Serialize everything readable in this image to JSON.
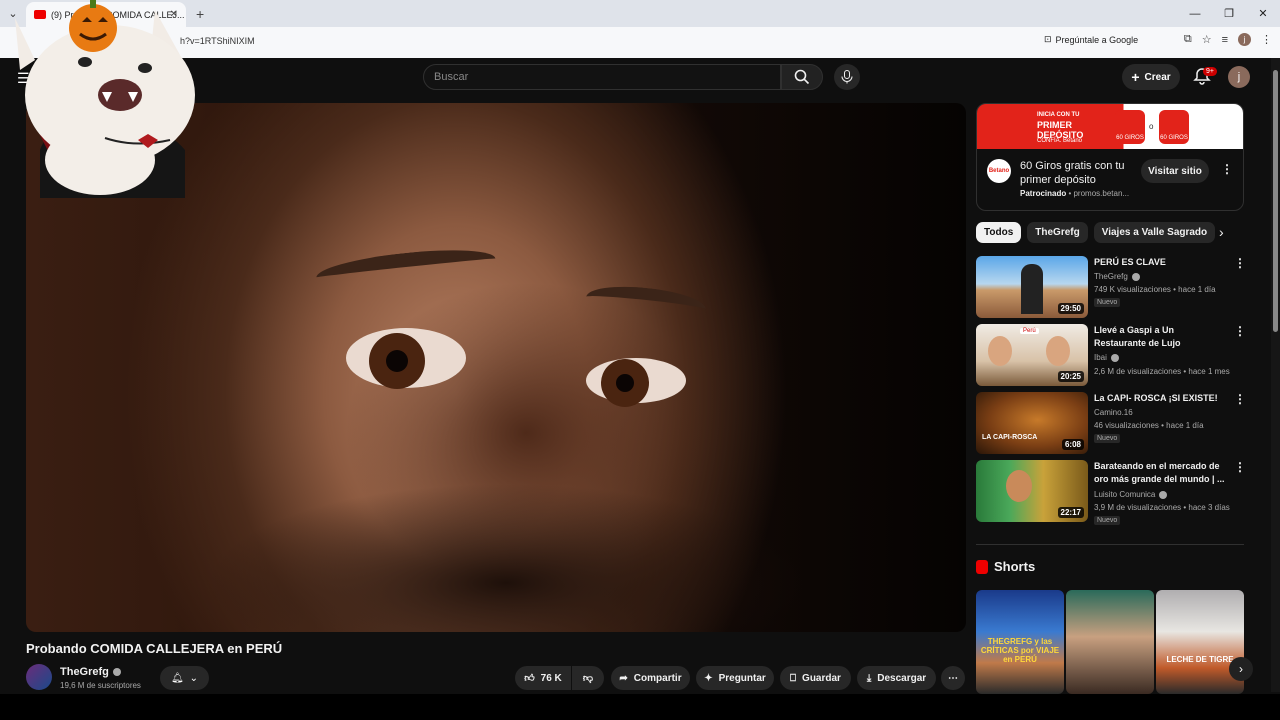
{
  "browser": {
    "tab_title": "(9) Probando COMIDA CALLEJ...",
    "url_text": "h?v=1RTShiNIXIM",
    "google_button": "Pregúntale a Google",
    "profile_letter": "j"
  },
  "header": {
    "search_placeholder": "Buscar",
    "create_label": "Crear",
    "notif_badge": "9+",
    "avatar_letter": "j"
  },
  "video": {
    "title": "Probando COMIDA CALLEJERA en PERÚ",
    "channel": "TheGrefg",
    "subscribers": "19,6 M de suscriptores",
    "likes": "76 K",
    "share_label": "Compartir",
    "ask_label": "Preguntar",
    "save_label": "Guardar",
    "download_label": "Descargar"
  },
  "ad": {
    "banner_line1": "INICIA CON TU",
    "banner_line2": "PRIMER DEPÓSITO",
    "banner_line3": "CONFÍA. Betano",
    "coin1": "60 GIROS",
    "coin_or": "o",
    "coin2": "60 GIROS",
    "logo": "Betano",
    "title": "60 Giros gratis con tu primer depósito",
    "sponsored": "Patrocinado",
    "domain": "promos.betan...",
    "visit": "Visitar sitio"
  },
  "chips": [
    "Todos",
    "TheGrefg",
    "Viajes a Valle Sagrado"
  ],
  "recommendations": [
    {
      "title": "PERÚ ES CLAVE",
      "channel": "TheGrefg",
      "meta": "749 K visualizaciones • hace 1 día",
      "badge": "Nuevo",
      "duration": "29:50"
    },
    {
      "title": "Llevé a Gaspi a Un Restaurante de Lujo",
      "channel": "Ibai",
      "meta": "2,6 M de visualizaciones • hace 1 mes",
      "badge": "",
      "duration": "20:25"
    },
    {
      "title": "La CAPI- ROSCA ¡SI EXISTE!",
      "channel": "Camino.16",
      "meta": "46 visualizaciones • hace 1 día",
      "badge": "Nuevo",
      "duration": "6:08"
    },
    {
      "title": "Barateando en el mercado de oro más grande del mundo | ...",
      "channel": "Luisito Comunica",
      "meta": "3,9 M de visualizaciones • hace 3 días",
      "badge": "Nuevo",
      "duration": "22:17"
    }
  ],
  "shorts": {
    "heading": "Shorts",
    "items": [
      {
        "caption": "THEGREFG y las CRÍTICAS por VIAJE en PERÚ"
      },
      {
        "caption": ""
      },
      {
        "caption": "LECHE DE TIGRE"
      }
    ]
  },
  "thumb_overlays": {
    "peru_tag": "Perú",
    "capi": "LA CAPI-ROSCA"
  }
}
